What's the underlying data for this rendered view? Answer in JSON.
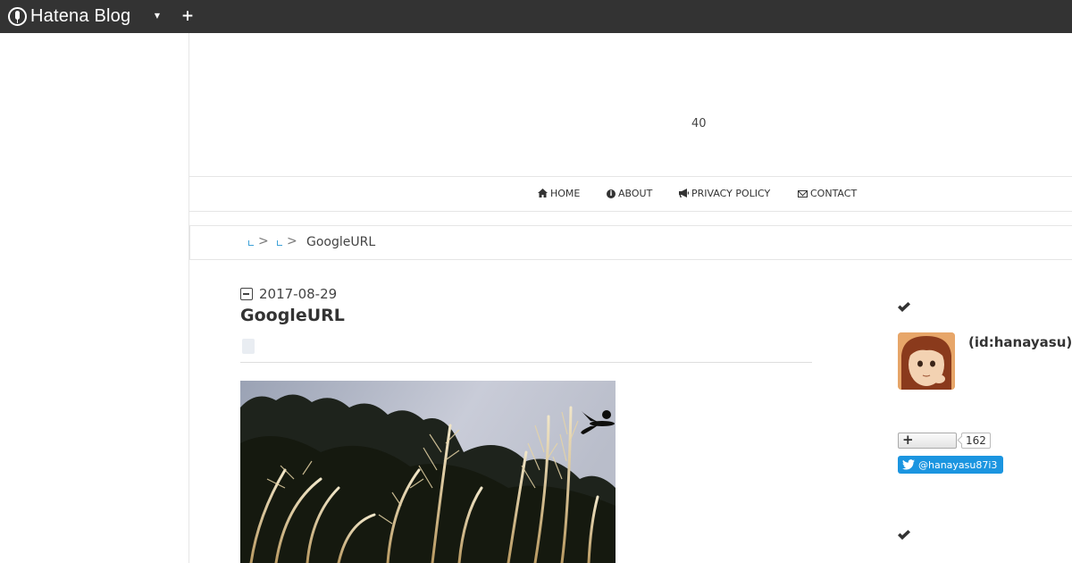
{
  "topbar": {
    "brand": "Hatena Blog",
    "logo_icon": "hatena-logo-icon",
    "dropdown_icon": "caret-down-icon",
    "add_icon": "plus-icon"
  },
  "header": {
    "description": "40"
  },
  "nav": {
    "items": [
      {
        "label": "HOME",
        "icon": "home-icon"
      },
      {
        "label": "ABOUT",
        "icon": "info-icon"
      },
      {
        "label": "PRIVACY POLICY",
        "icon": "bullhorn-icon"
      },
      {
        "label": "CONTACT",
        "icon": "envelope-icon"
      }
    ]
  },
  "breadcrumb": {
    "separator": ">",
    "current": "GoogleURL"
  },
  "entry": {
    "date": "2017-08-29",
    "title": "GoogleURL"
  },
  "sidebar": {
    "author_id": "(id:hanayasu)",
    "hatena_bookmark_count": "162",
    "twitter_handle": "@hanayasu87i3"
  },
  "colors": {
    "topbar": "#333333",
    "link": "#3fa2d8",
    "twitter": "#1b95e0"
  }
}
